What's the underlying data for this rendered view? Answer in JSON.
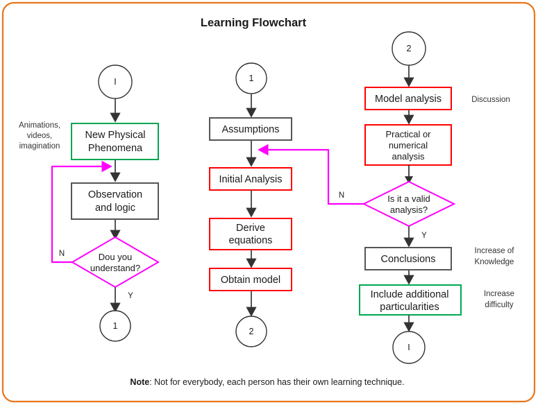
{
  "diagram": {
    "title": "Learning Flowchart",
    "frame_color": "#E8761B",
    "note_prefix": "Note",
    "note_text": ": Not for everybody, each person has their own learning technique."
  },
  "colors": {
    "gray": "#555555",
    "red": "#FF0000",
    "green": "#00A651",
    "magenta": "#FF00FF",
    "orange": "#E8761B"
  },
  "columns": {
    "left": {
      "start_connector": "I",
      "nodes": [
        {
          "id": "new-physical-phenomena",
          "line1": "New Physical",
          "line2": "Phenomena",
          "color": "green"
        },
        {
          "id": "observation-and-logic",
          "line1": "Observation",
          "line2": "and logic",
          "color": "gray"
        }
      ],
      "decision": {
        "id": "dou-you-understand",
        "line1": "Dou you",
        "line2": "understand?",
        "no_label": "N",
        "yes_label": "Y"
      },
      "end_connector": "1",
      "side_note": {
        "line1": "Animations,",
        "line2": "videos,",
        "line3": "imagination"
      }
    },
    "middle": {
      "start_connector": "1",
      "nodes": [
        {
          "id": "assumptions",
          "line1": "Assumptions",
          "line2": "",
          "color": "gray"
        },
        {
          "id": "initial-analysis",
          "line1": "Initial Analysis",
          "line2": "",
          "color": "red"
        },
        {
          "id": "derive-equations",
          "line1": "Derive",
          "line2": "equations",
          "color": "red"
        },
        {
          "id": "obtain-model",
          "line1": "Obtain model",
          "line2": "",
          "color": "red"
        }
      ],
      "end_connector": "2"
    },
    "right": {
      "start_connector": "2",
      "nodes": [
        {
          "id": "model-analysis",
          "line1": "Model analysis",
          "line2": "",
          "line3": "",
          "color": "red",
          "side": "Discussion"
        },
        {
          "id": "practical-or-numerical-analysis",
          "line1": "Practical or",
          "line2": "numerical",
          "line3": "analysis",
          "color": "red",
          "side": ""
        }
      ],
      "decision": {
        "id": "is-it-a-valid-analysis",
        "line1": "Is it a valid",
        "line2": "analysis?",
        "no_label": "N",
        "yes_label": "Y"
      },
      "nodes_after": [
        {
          "id": "conclusions",
          "line1": "Conclusions",
          "line2": "",
          "color": "gray",
          "side_line1": "Increase of",
          "side_line2": "Knowledge"
        },
        {
          "id": "include-additional-particularities",
          "line1": "Include additional",
          "line2": "particularities",
          "color": "green",
          "side_line1": "Increase",
          "side_line2": "difficulty"
        }
      ],
      "end_connector": "I"
    }
  }
}
